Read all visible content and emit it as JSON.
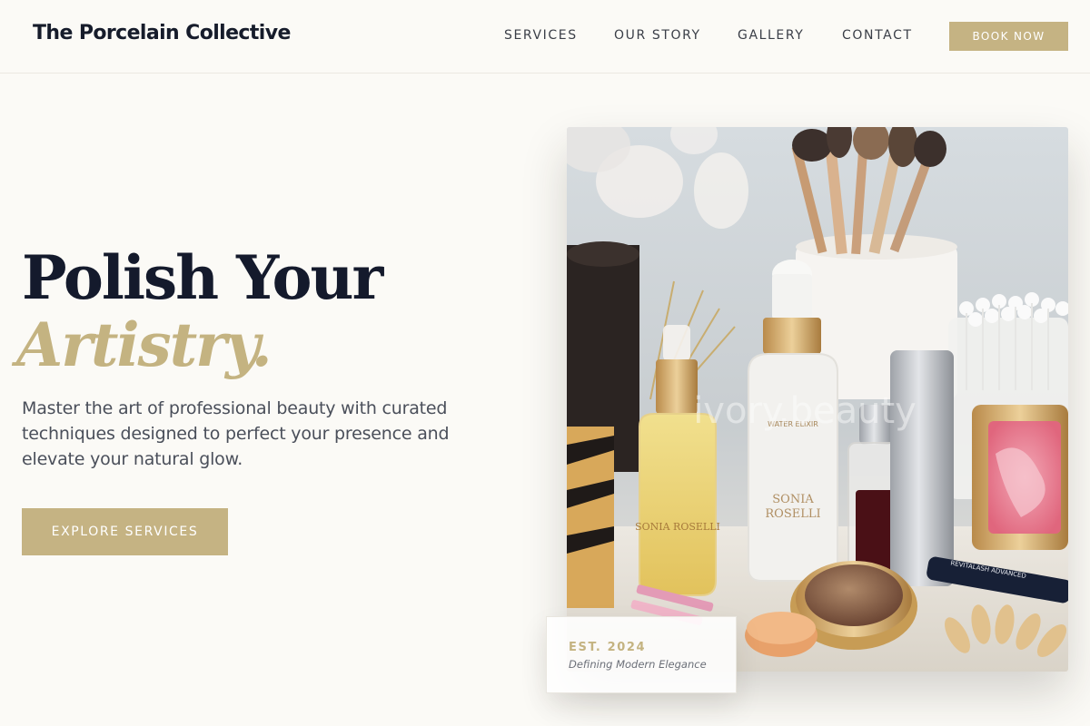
{
  "header": {
    "brand": "The Porcelain Collective",
    "nav": {
      "services": "SERVICES",
      "story": "OUR STORY",
      "gallery": "GALLERY",
      "contact": "CONTACT"
    },
    "cta": "BOOK NOW"
  },
  "hero": {
    "title": "Polish Your",
    "title_accent": "Artistry.",
    "description": "Master the art of professional beauty with curated techniques designed to perfect your presence and elevate your natural glow.",
    "cta": "EXPLORE SERVICES"
  },
  "image": {
    "watermark": "ivory.beauty",
    "products": {
      "serum_brand": "SONIA ROSELLI",
      "elixir_name": "WATER ELIXIR",
      "elixir_brand_line1": "SONIA",
      "elixir_brand_line2": "ROSELLI",
      "lash_label": "REVITALASH ADVANCED"
    }
  },
  "badge": {
    "year": "EST. 2024",
    "tagline": "Defining Modern Elegance"
  },
  "colors": {
    "accent": "#c5b383",
    "heading": "#141a2c",
    "background": "#fbfaf6"
  }
}
